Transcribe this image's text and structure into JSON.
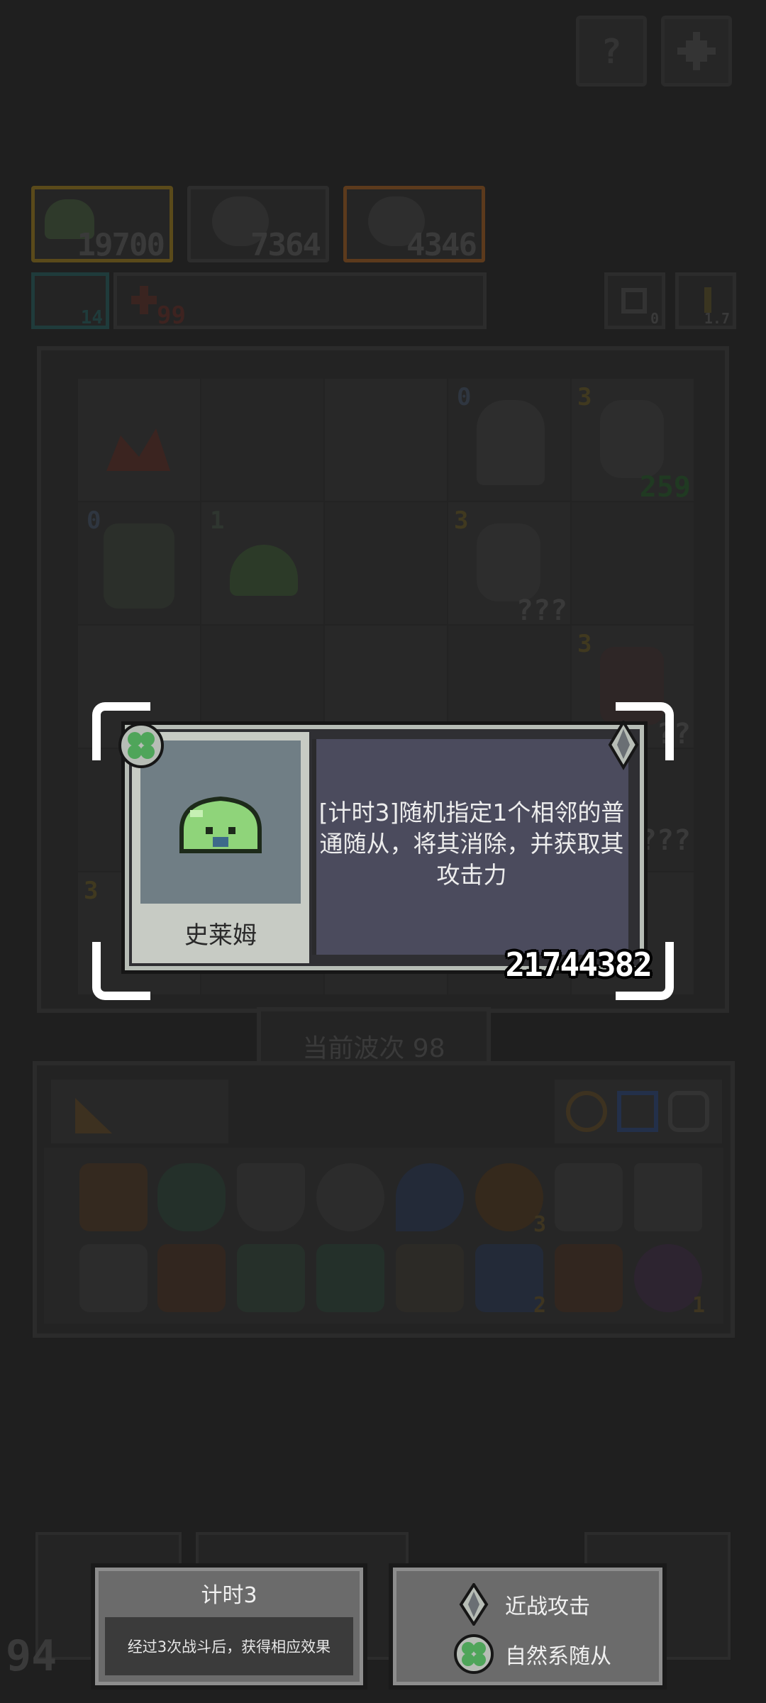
{
  "top_buttons": {
    "help_icon": "question-icon",
    "settings_icon": "gear-icon"
  },
  "heroes": [
    {
      "icon": "slime-hero",
      "value": "19700"
    },
    {
      "icon": "girl-hero",
      "value": "7364"
    },
    {
      "icon": "girl-hero",
      "value": "4346"
    }
  ],
  "stats": {
    "left_badge": "14",
    "red_badge": "99",
    "undo_count": "0",
    "key_count": "1.7"
  },
  "board": {
    "cells": [
      {
        "level": "",
        "value": ""
      },
      {
        "level": "0",
        "value": ""
      },
      {
        "level": "3",
        "value": "259"
      },
      {
        "level": "0",
        "value": ""
      },
      {
        "level": "1",
        "value": ""
      },
      {
        "level": "3",
        "value": "???"
      },
      {
        "level": "3",
        "value": "??"
      },
      {
        "level": "3",
        "value": ""
      }
    ],
    "side_value": "???"
  },
  "wave": {
    "label": "当前波次 98"
  },
  "inventory": {
    "badges": [
      "3",
      "2",
      "1"
    ]
  },
  "card": {
    "name": "史莱姆",
    "description": "[计时3]随机指定1个相邻的普通随从，将其消除，并获取其攻击力",
    "power": "21744382",
    "badge_left_icon": "clover-icon",
    "badge_right_icon": "sword-icon"
  },
  "tooltips": {
    "timer": {
      "title": "计时3",
      "text": "经过3次战斗后，获得相应效果"
    },
    "tags": [
      {
        "icon": "sword-icon",
        "label": "近战攻击"
      },
      {
        "icon": "clover-icon",
        "label": "自然系随从"
      }
    ]
  },
  "corner_number": "94",
  "colors": {
    "background": "#1f1f1f",
    "card_desc": "#4b4b5d",
    "portrait": "#707e85",
    "slime": "#8fd47a"
  }
}
